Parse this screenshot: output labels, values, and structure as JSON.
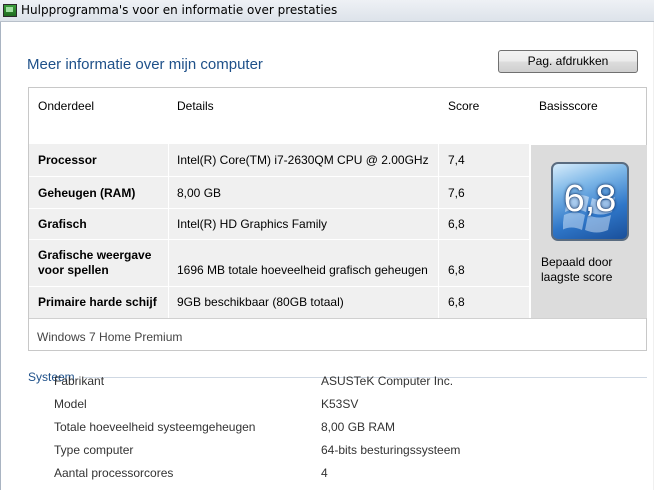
{
  "window": {
    "title": "Hulpprogramma's voor en informatie over prestaties",
    "icon": "performance-app-icon"
  },
  "page": {
    "heading": "Meer informatie over mijn computer",
    "print_button": "Pag. afdrukken"
  },
  "score_table": {
    "headers": {
      "component": "Onderdeel",
      "details": "Details",
      "score": "Score",
      "base_score": "Basisscore"
    },
    "rows": [
      {
        "component": "Processor",
        "details": "Intel(R) Core(TM) i7-2630QM CPU @ 2.00GHz",
        "score": "7,4"
      },
      {
        "component": "Geheugen (RAM)",
        "details": "8,00 GB",
        "score": "7,6"
      },
      {
        "component": "Grafisch",
        "details": "Intel(R) HD Graphics Family",
        "score": "6,8"
      },
      {
        "component": "Grafische weergave voor spellen",
        "component_line1": "Grafische weergave",
        "component_line2": "voor spellen",
        "details": "1696 MB totale hoeveelheid grafisch geheugen",
        "score": "6,8"
      },
      {
        "component": "Primaire harde schijf",
        "details": "9GB beschikbaar (80GB totaal)",
        "score": "6,8"
      }
    ],
    "base_score": {
      "value": "6,8",
      "caption": "Bepaald door laagste score",
      "badge_color": "#2f77c9"
    },
    "edition": "Windows 7 Home Premium"
  },
  "system": {
    "label": "Systeem",
    "rows": [
      {
        "key": "Fabrikant",
        "value": "ASUSTeK Computer Inc."
      },
      {
        "key": "Model",
        "value": "K53SV"
      },
      {
        "key": "Totale hoeveelheid systeemgeheugen",
        "value": "8,00 GB RAM"
      },
      {
        "key": "Type computer",
        "value": "64-bits besturingssysteem"
      },
      {
        "key": "Aantal processorcores",
        "value": "4"
      }
    ]
  },
  "colors": {
    "accent_text": "#1e5089",
    "row_background": "#f0f0f0",
    "base_panel": "#dcdcdc"
  }
}
